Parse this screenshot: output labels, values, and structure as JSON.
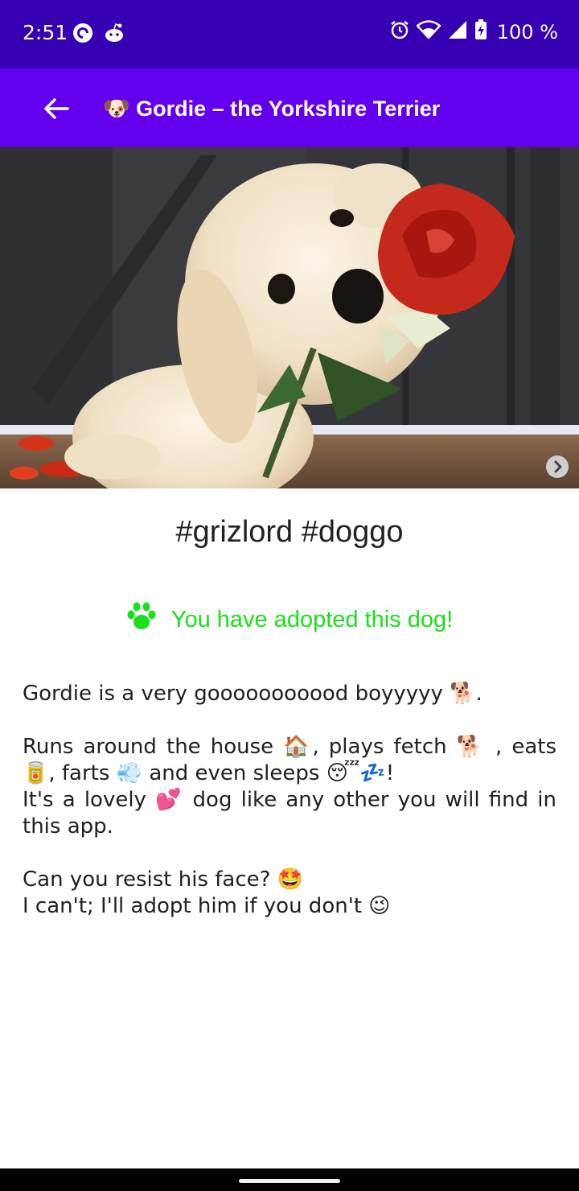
{
  "status_bar": {
    "time": "2:51",
    "battery": "100 %",
    "icons": [
      "pocket-casts-icon",
      "reddit-icon",
      "alarm-icon",
      "wifi-icon",
      "cell-signal-icon",
      "battery-charging-icon"
    ]
  },
  "app_bar": {
    "title": "🐶 Gordie – the Yorkshire Terrier",
    "back_icon": "arrow-left-icon",
    "background": "#6200ee",
    "status_background": "#3700b3"
  },
  "photo": {
    "subject": "white puppy holding a red rose",
    "next_icon": "chevron-right-icon"
  },
  "hashtags": "#grizlord #doggo",
  "adopted": {
    "icon": "paw-icon",
    "text": "You have adopted this dog!",
    "color": "#1adf1a"
  },
  "description": {
    "line1": "Gordie is a very gooooooooood boyyyyy 🐕.",
    "line2": "Runs around the house 🏠, plays fetch 🐕 , eats 🥫, farts 💨 and even sleeps 😴💤!",
    "line3": "It's a lovely 💕 dog like any other you will find in this app.",
    "line4": "Can you resist his face? 🤩",
    "line5": "I can't; I'll adopt him if you don't 😉"
  }
}
